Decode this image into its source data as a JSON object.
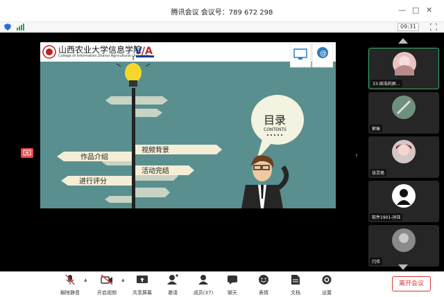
{
  "window": {
    "title": "腾讯会议 会议号：789 672 298",
    "minimize": "—",
    "maximize": "□",
    "close": "✕"
  },
  "status": {
    "timer": "09:31"
  },
  "slide": {
    "school_name": "山西农业大学信息学院",
    "school_name_en": "College of Information,Shanxi Agricultural University",
    "toc_title": "目录",
    "toc_subtitle": "CONTENTS",
    "bulb_label": "IDEA",
    "signs": [
      "作品介绍",
      "视频背景",
      "活动完结",
      "进行评分"
    ]
  },
  "participants": [
    {
      "name": "33-田浩的屏..."
    },
    {
      "name": "郭振"
    },
    {
      "name": "张灵艳"
    },
    {
      "name": "软件1901-孙钰"
    },
    {
      "name": "闫伟"
    }
  ],
  "toolbar": {
    "unmute": "解除静音",
    "start_video": "开启视频",
    "share_screen": "共享屏幕",
    "invite": "邀请",
    "members": "成员(37)",
    "chat": "聊天",
    "reactions": "表情",
    "documents": "文档",
    "settings": "设置",
    "leave": "离开会议"
  },
  "colors": {
    "slide_bg": "#5a8f8f",
    "leave_red": "#d33333",
    "active_green": "#3bb06a"
  }
}
